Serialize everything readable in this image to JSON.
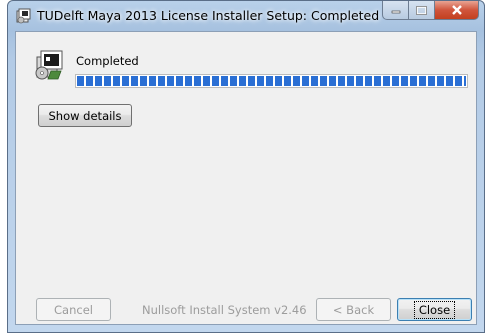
{
  "window": {
    "title": "TUDelft Maya 2013 License Installer Setup: Completed"
  },
  "status": {
    "text": "Completed",
    "progress_fraction": 1.0
  },
  "buttons": {
    "show_details": "Show details",
    "cancel": "Cancel",
    "back": "< Back",
    "close": "Close"
  },
  "branding": {
    "text": "Nullsoft Install System v2.46"
  },
  "colors": {
    "progress": "#2b6fd4",
    "title_bar": "#b9d1ea"
  },
  "icons": {
    "title": "installer-icon",
    "big": "installer-box-cd-icon",
    "min": "minimize-icon",
    "max": "maximize-icon",
    "close": "close-icon"
  }
}
